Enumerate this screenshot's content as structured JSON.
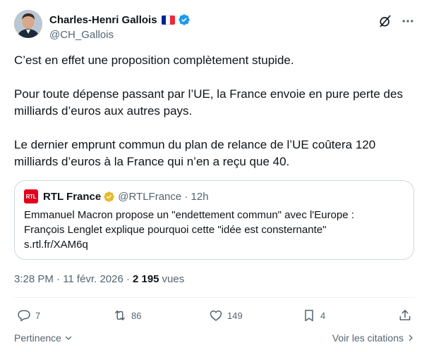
{
  "author": {
    "name": "Charles-Henri Gallois",
    "handle": "@CH_Gallois",
    "flag_colors": [
      "#002395",
      "#ffffff",
      "#ed2939"
    ],
    "verified_color": "#1d9bf0"
  },
  "header_icons": [
    "grok-icon",
    "more-icon"
  ],
  "tweet": {
    "paragraphs": [
      "C’est en effet une proposition complètement stupide.",
      "Pour toute dépense passant par l’UE, la France envoie en pure perte des milliards d’euros aux autres pays.",
      "Le dernier emprunt commun du plan de relance de l’UE coûtera 120 milliards d’euros à la France qui n’en a reçu que 40."
    ]
  },
  "quote": {
    "logo_text": "RTL",
    "logo_color": "#e2001a",
    "name": "RTL France",
    "badge_color": "#e8b829",
    "handle_time": "@RTLFrance · 12h",
    "line1": "Emmanuel Macron propose un \"endettement commun\" avec l'Europe :",
    "line2": "François Lenglet explique pourquoi cette \"idée est consternante\"",
    "link": "s.rtl.fr/XAM6q"
  },
  "meta": {
    "time_date": "3:28 PM · 11 févr. 2026 ·",
    "views_count": "2 195",
    "views_label": "vues"
  },
  "actions": {
    "replies": "7",
    "reposts": "86",
    "likes": "149",
    "bookmarks": "4"
  },
  "footer": {
    "sort_label": "Pertinence",
    "quotes_label": "Voir les citations"
  }
}
